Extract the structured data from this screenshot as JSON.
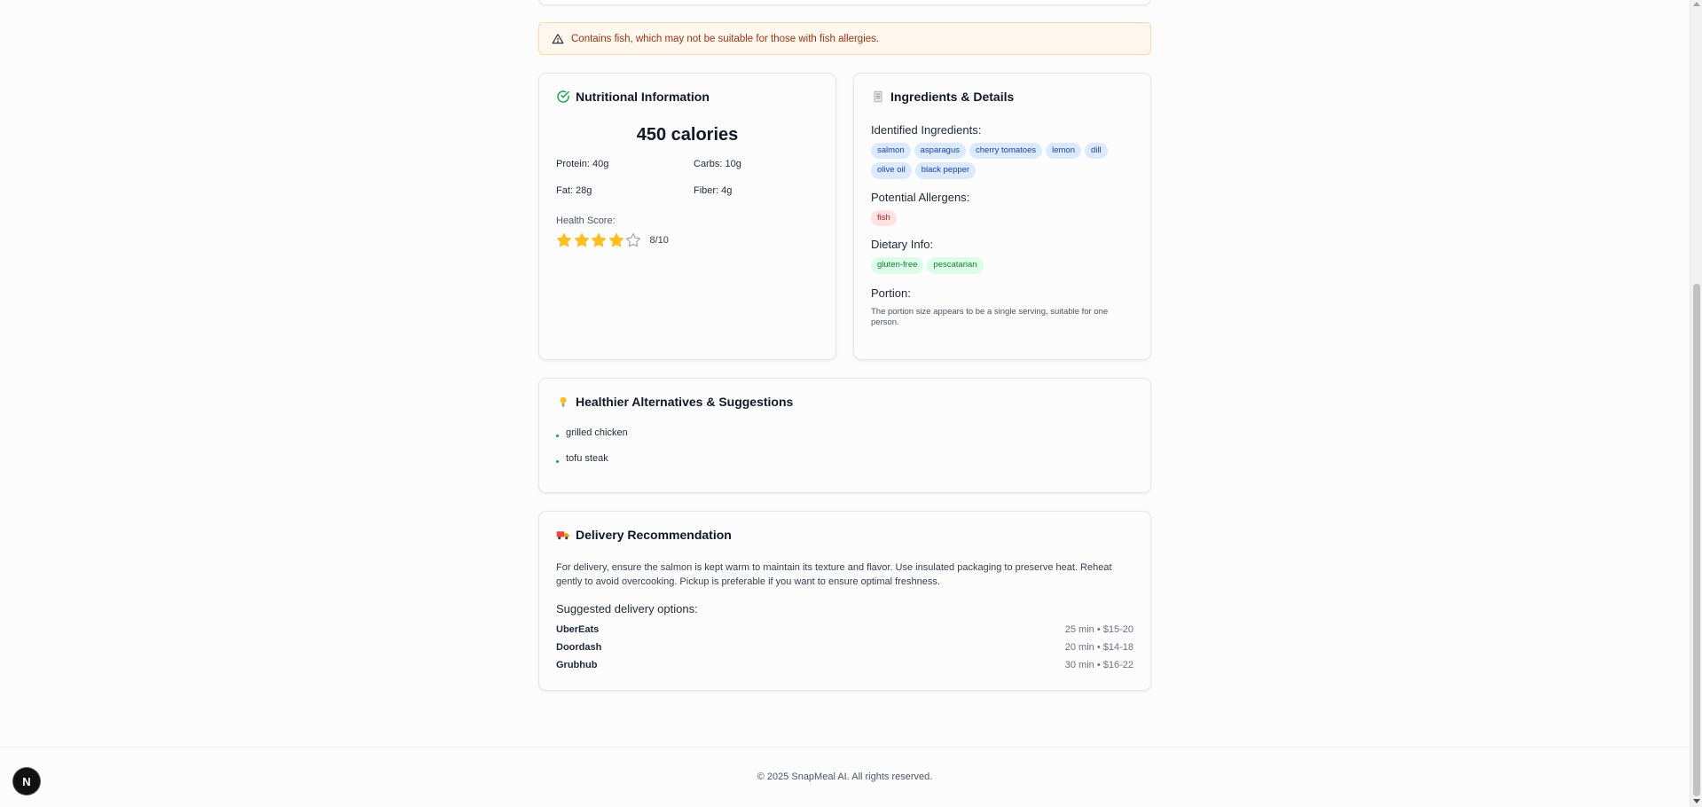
{
  "warning": {
    "icon": "warning-triangle-icon",
    "text": "Contains fish, which may not be suitable for those with fish allergies."
  },
  "nutrition": {
    "title": "Nutritional Information",
    "icon": "check-circle-icon",
    "calories": "450 calories",
    "protein": "Protein: 40g",
    "carbs": "Carbs: 10g",
    "fat": "Fat: 28g",
    "fiber": "Fiber: 4g",
    "health_label": "Health Score:",
    "health_score_text": "8/10",
    "stars_filled": 4,
    "stars_total": 5,
    "star_color": "#fbbf24"
  },
  "ingredients": {
    "title": "Ingredients & Details",
    "icon": "document-icon",
    "identified_label": "Identified Ingredients:",
    "identified": [
      "salmon",
      "asparagus",
      "cherry tomatoes",
      "lemon",
      "dill",
      "olive oil",
      "black pepper"
    ],
    "allergens_label": "Potential Allergens:",
    "allergens": [
      "fish"
    ],
    "dietary_label": "Dietary Info:",
    "dietary": [
      "gluten-free",
      "pescatarian"
    ],
    "portion_label": "Portion:",
    "portion_text": "The portion size appears to be a single serving, suitable for one person."
  },
  "alternatives": {
    "title": "Healthier Alternatives & Suggestions",
    "icon": "lightbulb-icon",
    "items": [
      "grilled chicken",
      "tofu steak"
    ]
  },
  "delivery": {
    "title": "Delivery Recommendation",
    "icon": "truck-icon",
    "text": "For delivery, ensure the salmon is kept warm to maintain its texture and flavor. Use insulated packaging to preserve heat. Reheat gently to avoid overcooking. Pickup is preferable if you want to ensure optimal freshness.",
    "options_label": "Suggested delivery options:",
    "options": [
      {
        "name": "UberEats",
        "meta": "25 min • $15-20"
      },
      {
        "name": "Doordash",
        "meta": "20 min • $14-18"
      },
      {
        "name": "Grubhub",
        "meta": "30 min • $16-22"
      }
    ]
  },
  "footer": {
    "text": "© 2025 SnapMeal AI. All rights reserved."
  },
  "dev_badge": {
    "label": "N"
  },
  "colors": {
    "accent_green": "#16a34a",
    "warning_bg": "#fff7ed",
    "warning_text": "#9a3412"
  }
}
